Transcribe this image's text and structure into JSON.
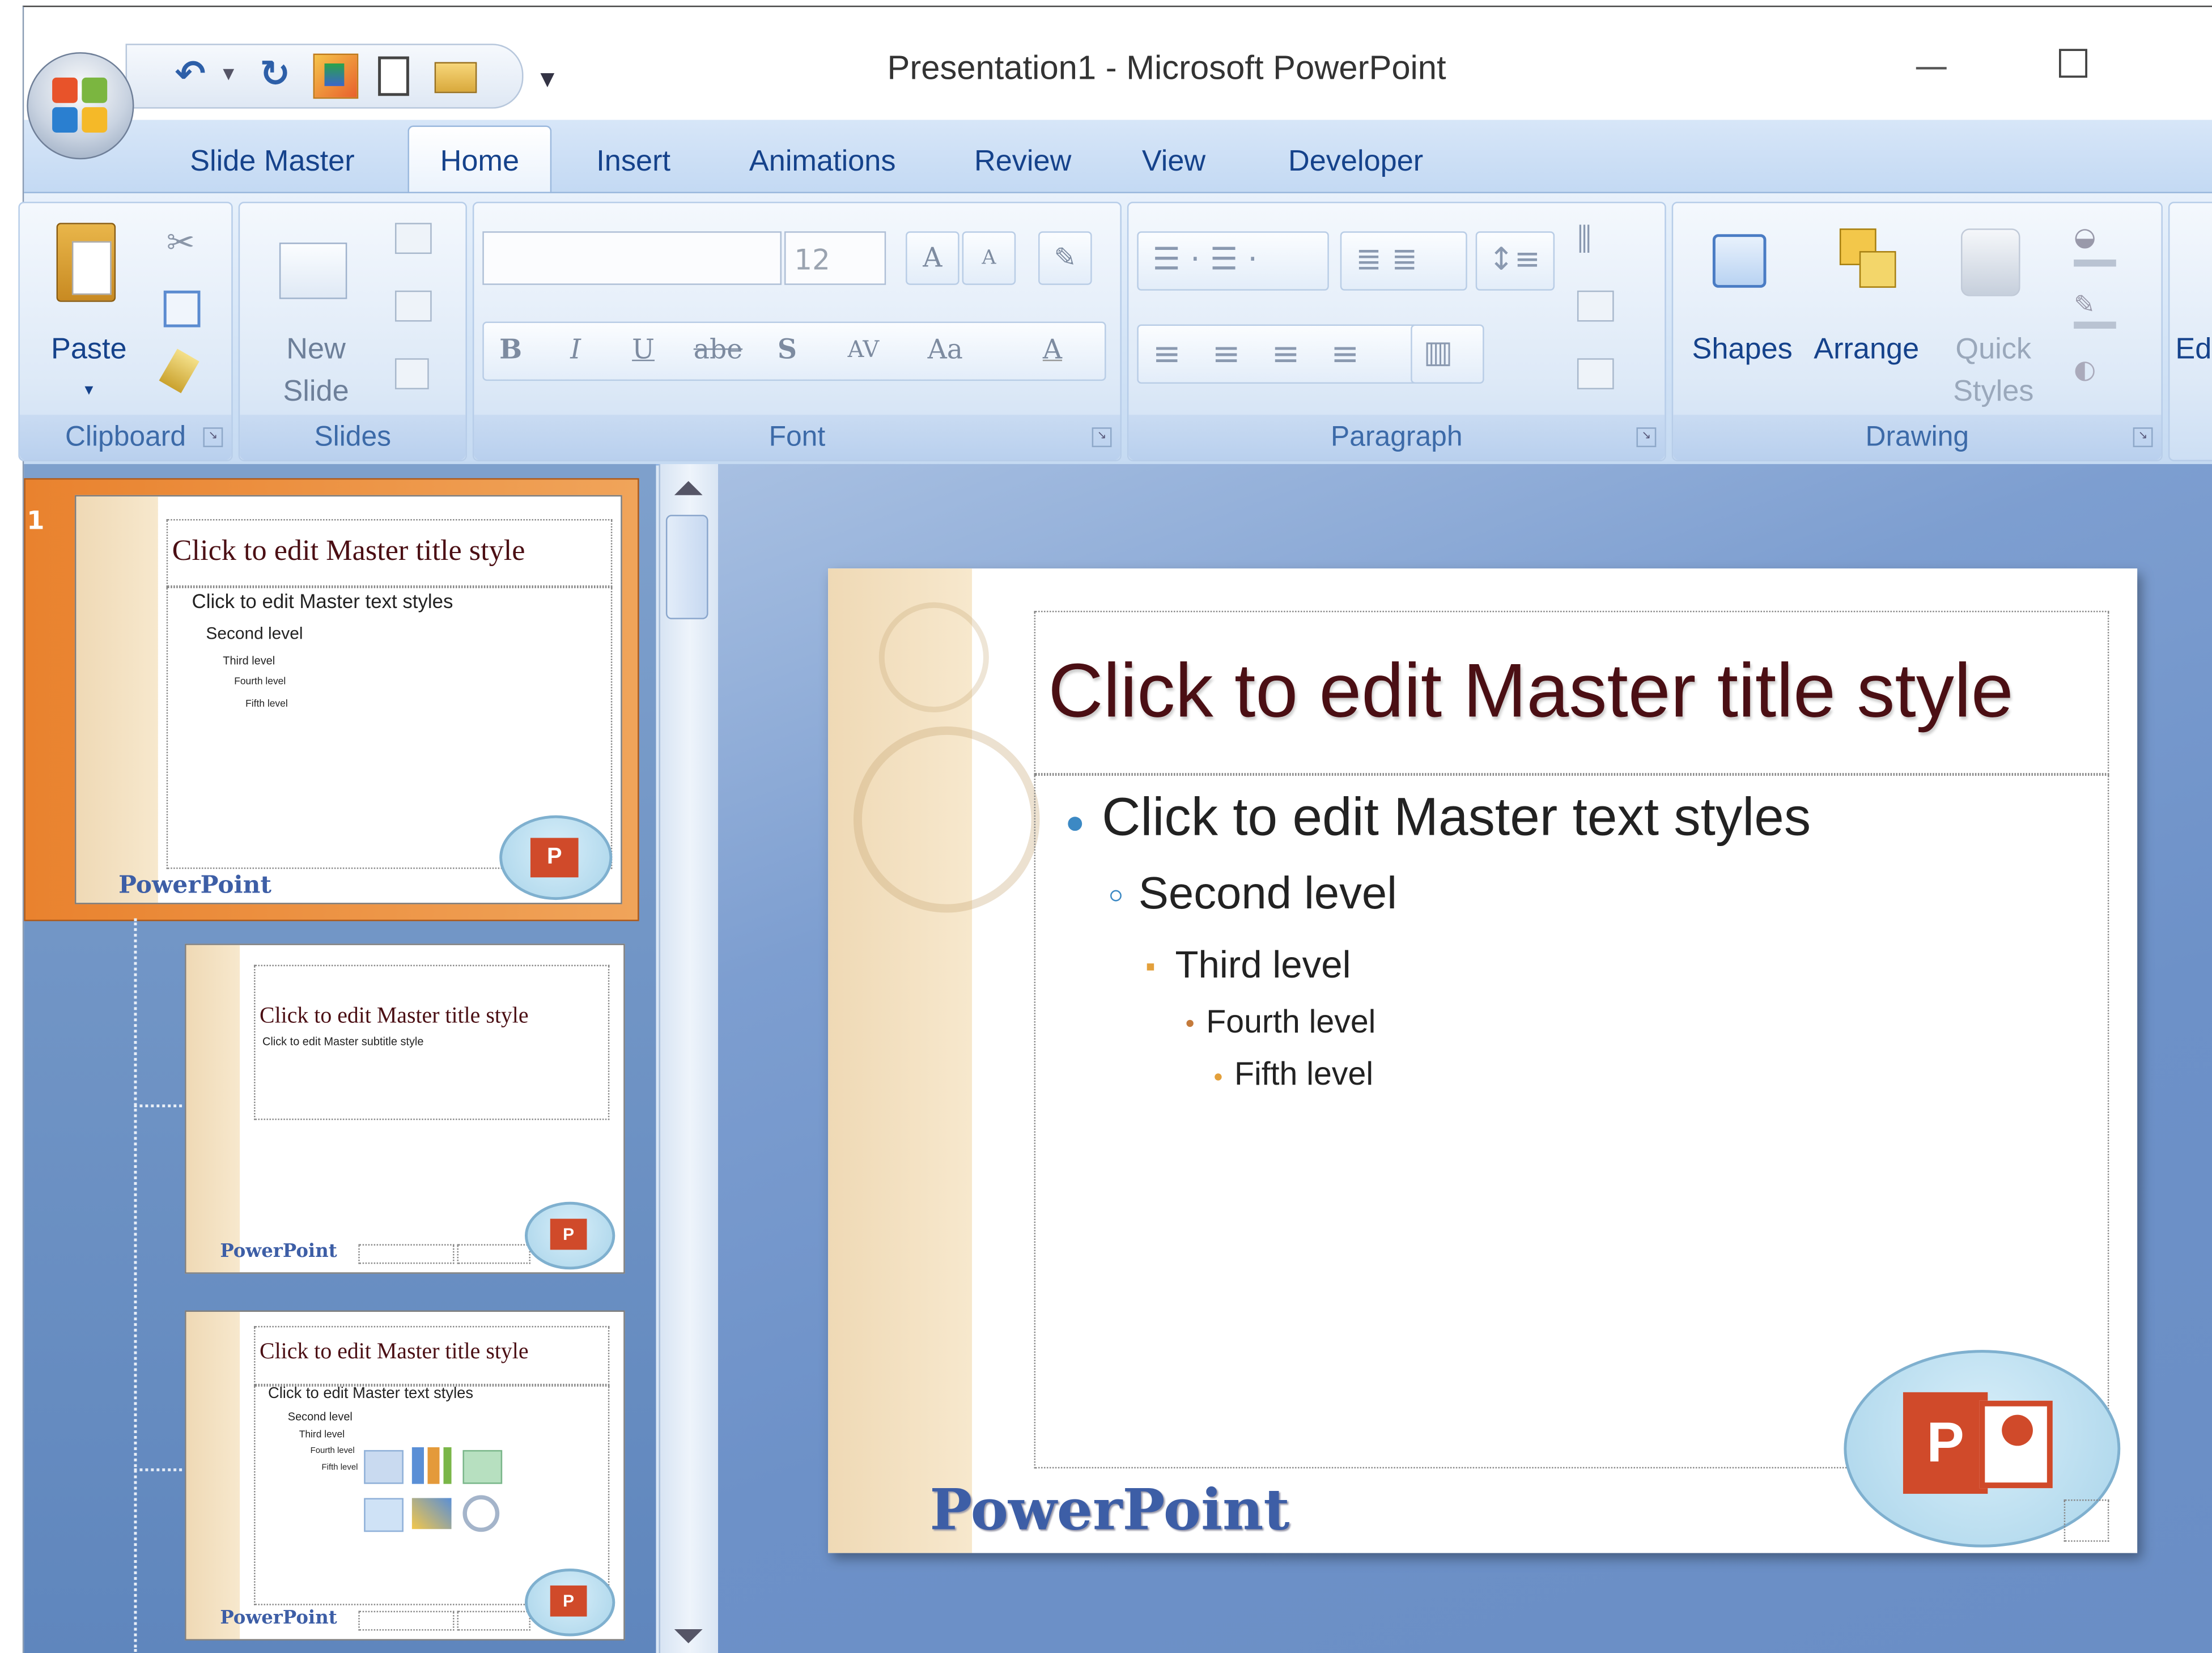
{
  "window": {
    "title": "Presentation1 - Microsoft PowerPoint",
    "minimize_glyph": "—",
    "maximize_glyph": "☐"
  },
  "qat": {
    "undo_glyph": "↶",
    "redo_glyph": "↻",
    "dropdown_glyph": "▾",
    "sep_glyph": "·"
  },
  "tabs": [
    "Slide Master",
    "Home",
    "Insert",
    "Animations",
    "Review",
    "View",
    "Developer"
  ],
  "active_tab": "Home",
  "ribbon": {
    "clipboard": {
      "label": "Clipboard",
      "paste": "Paste"
    },
    "slides": {
      "label": "Slides",
      "new_slide_1": "New",
      "new_slide_2": "Slide"
    },
    "font": {
      "label": "Font",
      "font_name": "",
      "font_size": "12",
      "grow": "A",
      "shrink": "A",
      "bold": "B",
      "italic": "I",
      "underline": "U",
      "strike": "abe",
      "shadow": "S",
      "spacing": "AV",
      "case": "Aa",
      "color": "A"
    },
    "paragraph": {
      "label": "Paragraph"
    },
    "drawing": {
      "label": "Drawing",
      "shapes": "Shapes",
      "arrange": "Arrange",
      "quick_1": "Quick",
      "quick_2": "Styles"
    },
    "editing": {
      "label_partial": "Ed"
    }
  },
  "thumbnails": [
    {
      "number": "1",
      "title": "Click to edit Master title style",
      "lines": [
        "Click to edit Master text styles",
        "Second level",
        "Third level",
        "Fourth level",
        "Fifth level"
      ],
      "brand": "PowerPoint"
    },
    {
      "title": "Click to edit Master title style",
      "subtitle": "Click to edit Master subtitle style",
      "brand": "PowerPoint"
    },
    {
      "title": "Click to edit Master title style",
      "lines": [
        "Click to edit Master text styles",
        "Second level",
        "Third level",
        "Fourth level",
        "Fifth level"
      ],
      "brand": "PowerPoint"
    }
  ],
  "slide": {
    "title": "Click to edit Master title style",
    "levels": [
      "Click to edit Master text styles",
      "Second level",
      "Third level",
      "Fourth level",
      "Fifth level"
    ],
    "brand": "PowerPoint",
    "logo_letter": "P"
  },
  "colors": {
    "title": "#4b0f14",
    "accent_tab": "#15428b",
    "selected_thumb": "#e07d2e",
    "bullet_l1": "#3c89c4",
    "bullet_l3": "#e3a03b"
  }
}
